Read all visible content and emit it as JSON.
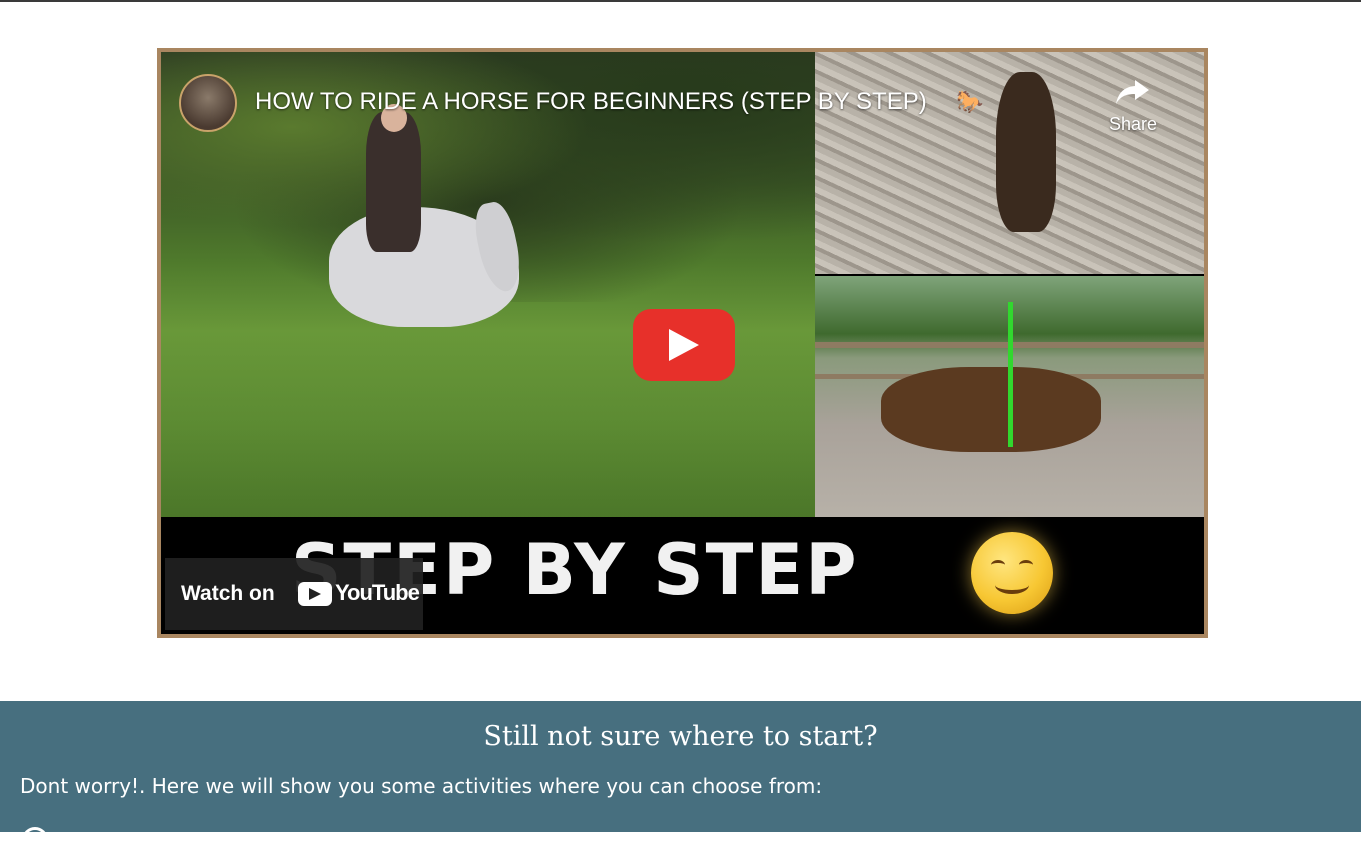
{
  "video": {
    "title": "HOW TO RIDE A HORSE FOR BEGINNERS (STEP BY STEP)",
    "share_label": "Share",
    "caption_text": "STEP BY STEP",
    "watch_on_label": "Watch on",
    "youtube_label": "YouTube",
    "colors": {
      "frame_border": "#a98660",
      "play_button": "#e7302a"
    }
  },
  "info": {
    "heading": "Still not sure where to start?",
    "text": "Dont worry!. Here we will show you some activities where you can choose from:",
    "background": "#476f7f"
  }
}
